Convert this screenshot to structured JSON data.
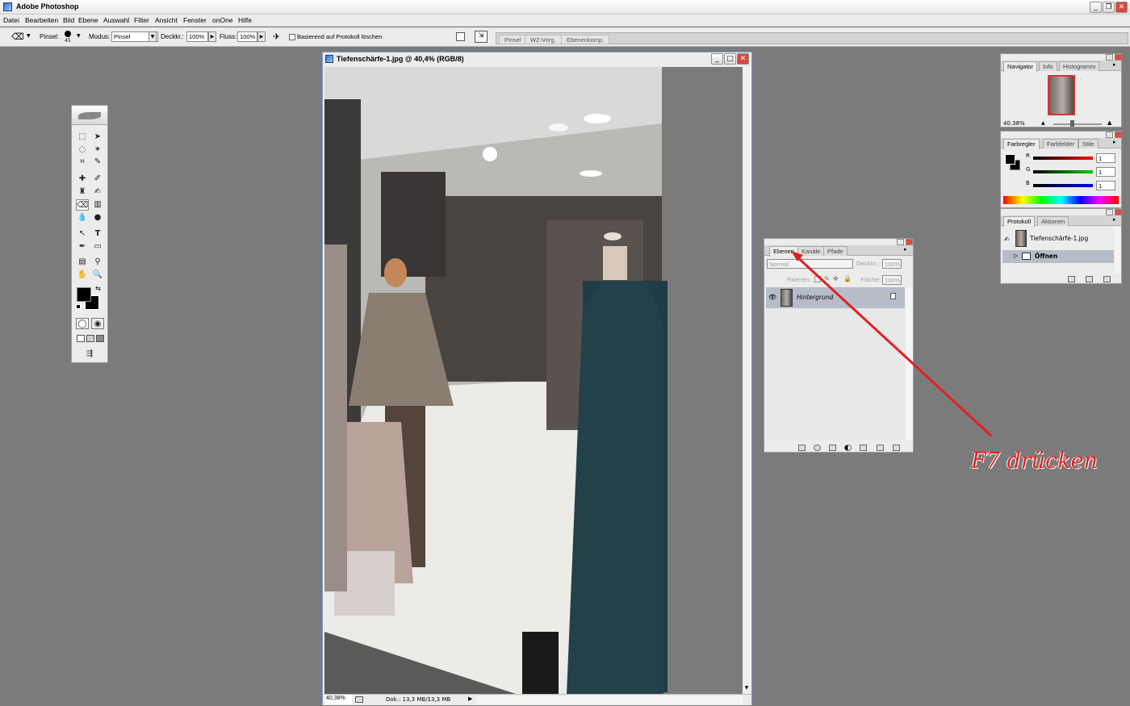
{
  "app": {
    "title": "Adobe Photoshop"
  },
  "menu": [
    "Datei",
    "Bearbeiten",
    "Bild",
    "Ebene",
    "Auswahl",
    "Filter",
    "Ansicht",
    "Fenster",
    "onOne",
    "Hilfe"
  ],
  "options": {
    "brush_label": "Pinsel:",
    "brush_size": "45",
    "mode_label": "Modus:",
    "mode_value": "Pinsel",
    "opacity_label": "Deckkr.:",
    "opacity_value": "100%",
    "flow_label": "Fluss:",
    "flow_value": "100%",
    "history_checkbox": "Basierend auf Protokoll löschen",
    "well_tabs": [
      "Pinsel",
      "WZ-Vorg.",
      "Ebenenkomp."
    ]
  },
  "document": {
    "title": "Tiefenschärfe-1.jpg @ 40,4% (RGB/8)",
    "zoom": "40,38%",
    "doc_info": "Dok.: 13,3 MB/13,3 MB"
  },
  "navigator": {
    "tabs": [
      "Navigator",
      "Info",
      "Histogramm"
    ],
    "zoom": "40.38%"
  },
  "color": {
    "tabs": [
      "Farbregler",
      "Farbfelder",
      "Stile"
    ],
    "labels": [
      "R",
      "G",
      "B"
    ],
    "values": [
      "1",
      "1",
      "1"
    ]
  },
  "history": {
    "tabs": [
      "Protokoll",
      "Aktionen"
    ],
    "snapshot": "Tiefenschärfe-1.jpg",
    "step": "Öffnen"
  },
  "layers": {
    "tabs": [
      "Ebenen",
      "Kanäle",
      "Pfade"
    ],
    "blend": "Normal",
    "opacity_label": "Deckkr.:",
    "opacity_value": "100%",
    "lock_label": "Fixieren:",
    "fill_label": "Fläche:",
    "fill_value": "100%",
    "layer_name": "Hintergrund"
  },
  "annotation": "F7 drücken",
  "colors": {
    "annotation": "#e02020",
    "selected_row": "#b7bcc9",
    "title_blue": "#3b6bc8"
  }
}
